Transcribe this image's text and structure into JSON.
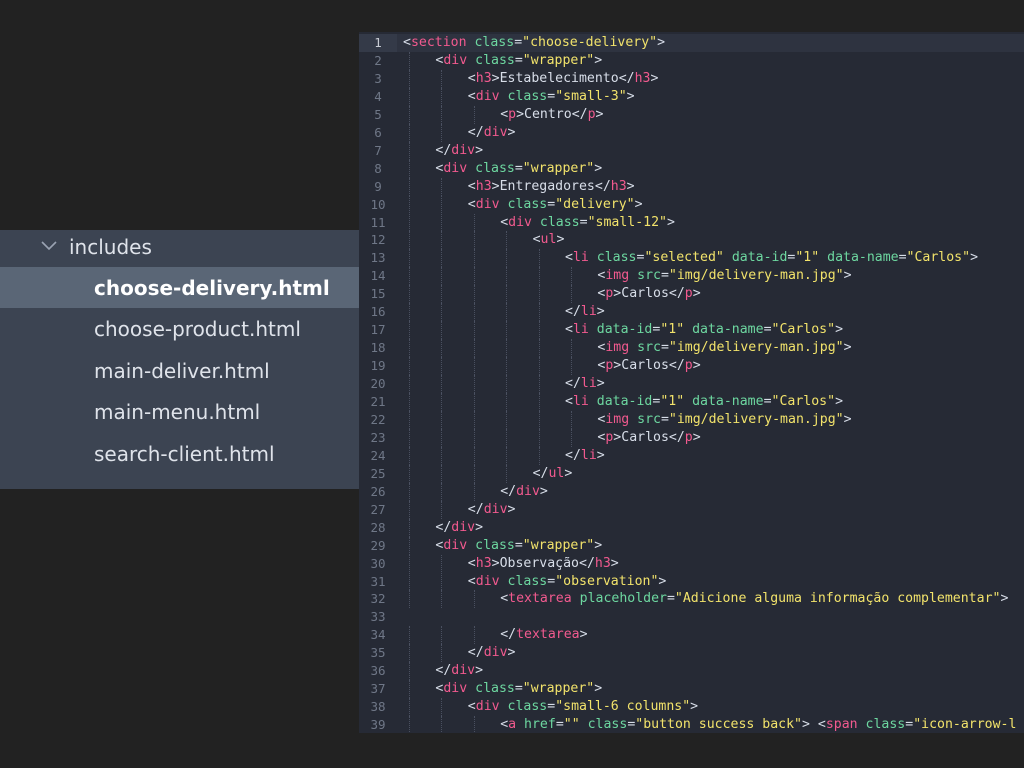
{
  "sidebar": {
    "folder": {
      "name": "includes",
      "icon": "chevron-down-icon"
    },
    "files": [
      {
        "name": "choose-delivery.html",
        "selected": true
      },
      {
        "name": "choose-product.html",
        "selected": false
      },
      {
        "name": "main-deliver.html",
        "selected": false
      },
      {
        "name": "main-menu.html",
        "selected": false
      },
      {
        "name": "search-client.html",
        "selected": false
      }
    ]
  },
  "editor": {
    "active_line": 1,
    "colors": {
      "tag": "#f25a8f",
      "attribute": "#6dd7a0",
      "string": "#f2e36b",
      "text": "#d8dee9"
    },
    "lines": [
      {
        "n": "1",
        "indent": 0,
        "tokens": [
          [
            "p",
            "<"
          ],
          [
            "tag",
            "section"
          ],
          [
            "p",
            " "
          ],
          [
            "attr",
            "class"
          ],
          [
            "p",
            "="
          ],
          [
            "str",
            "\"choose-delivery\""
          ],
          [
            "p",
            ">"
          ]
        ]
      },
      {
        "n": "2",
        "indent": 1,
        "tokens": [
          [
            "p",
            "<"
          ],
          [
            "tag",
            "div"
          ],
          [
            "p",
            " "
          ],
          [
            "attr",
            "class"
          ],
          [
            "p",
            "="
          ],
          [
            "str",
            "\"wrapper\""
          ],
          [
            "p",
            ">"
          ]
        ]
      },
      {
        "n": "3",
        "indent": 2,
        "tokens": [
          [
            "p",
            "<"
          ],
          [
            "tag",
            "h3"
          ],
          [
            "p",
            ">"
          ],
          [
            "t",
            "Estabelecimento"
          ],
          [
            "p",
            "</"
          ],
          [
            "tag",
            "h3"
          ],
          [
            "p",
            ">"
          ]
        ]
      },
      {
        "n": "4",
        "indent": 2,
        "tokens": [
          [
            "p",
            "<"
          ],
          [
            "tag",
            "div"
          ],
          [
            "p",
            " "
          ],
          [
            "attr",
            "class"
          ],
          [
            "p",
            "="
          ],
          [
            "str",
            "\"small-3\""
          ],
          [
            "p",
            ">"
          ]
        ]
      },
      {
        "n": "5",
        "indent": 3,
        "tokens": [
          [
            "p",
            "<"
          ],
          [
            "tag",
            "p"
          ],
          [
            "p",
            ">"
          ],
          [
            "t",
            "Centro"
          ],
          [
            "p",
            "</"
          ],
          [
            "tag",
            "p"
          ],
          [
            "p",
            ">"
          ]
        ]
      },
      {
        "n": "6",
        "indent": 2,
        "tokens": [
          [
            "p",
            "</"
          ],
          [
            "tag",
            "div"
          ],
          [
            "p",
            ">"
          ]
        ]
      },
      {
        "n": "7",
        "indent": 1,
        "tokens": [
          [
            "p",
            "</"
          ],
          [
            "tag",
            "div"
          ],
          [
            "p",
            ">"
          ]
        ]
      },
      {
        "n": "8",
        "indent": 1,
        "tokens": [
          [
            "p",
            "<"
          ],
          [
            "tag",
            "div"
          ],
          [
            "p",
            " "
          ],
          [
            "attr",
            "class"
          ],
          [
            "p",
            "="
          ],
          [
            "str",
            "\"wrapper\""
          ],
          [
            "p",
            ">"
          ]
        ]
      },
      {
        "n": "9",
        "indent": 2,
        "tokens": [
          [
            "p",
            "<"
          ],
          [
            "tag",
            "h3"
          ],
          [
            "p",
            ">"
          ],
          [
            "t",
            "Entregadores"
          ],
          [
            "p",
            "</"
          ],
          [
            "tag",
            "h3"
          ],
          [
            "p",
            ">"
          ]
        ]
      },
      {
        "n": "10",
        "indent": 2,
        "tokens": [
          [
            "p",
            "<"
          ],
          [
            "tag",
            "div"
          ],
          [
            "p",
            " "
          ],
          [
            "attr",
            "class"
          ],
          [
            "p",
            "="
          ],
          [
            "str",
            "\"delivery\""
          ],
          [
            "p",
            ">"
          ]
        ]
      },
      {
        "n": "11",
        "indent": 3,
        "tokens": [
          [
            "p",
            "<"
          ],
          [
            "tag",
            "div"
          ],
          [
            "p",
            " "
          ],
          [
            "attr",
            "class"
          ],
          [
            "p",
            "="
          ],
          [
            "str",
            "\"small-12\""
          ],
          [
            "p",
            ">"
          ]
        ]
      },
      {
        "n": "12",
        "indent": 4,
        "tokens": [
          [
            "p",
            "<"
          ],
          [
            "tag",
            "ul"
          ],
          [
            "p",
            ">"
          ]
        ]
      },
      {
        "n": "13",
        "indent": 5,
        "tokens": [
          [
            "p",
            "<"
          ],
          [
            "tag",
            "li"
          ],
          [
            "p",
            " "
          ],
          [
            "attr",
            "class"
          ],
          [
            "p",
            "="
          ],
          [
            "str",
            "\"selected\""
          ],
          [
            "p",
            " "
          ],
          [
            "attr",
            "data-id"
          ],
          [
            "p",
            "="
          ],
          [
            "str",
            "\"1\""
          ],
          [
            "p",
            " "
          ],
          [
            "attr",
            "data-name"
          ],
          [
            "p",
            "="
          ],
          [
            "str",
            "\"Carlos\""
          ],
          [
            "p",
            ">"
          ]
        ]
      },
      {
        "n": "14",
        "indent": 6,
        "tokens": [
          [
            "p",
            "<"
          ],
          [
            "tag",
            "img"
          ],
          [
            "p",
            " "
          ],
          [
            "attr",
            "src"
          ],
          [
            "p",
            "="
          ],
          [
            "str",
            "\"img/delivery-man.jpg\""
          ],
          [
            "p",
            ">"
          ]
        ]
      },
      {
        "n": "15",
        "indent": 6,
        "tokens": [
          [
            "p",
            "<"
          ],
          [
            "tag",
            "p"
          ],
          [
            "p",
            ">"
          ],
          [
            "t",
            "Carlos"
          ],
          [
            "p",
            "</"
          ],
          [
            "tag",
            "p"
          ],
          [
            "p",
            ">"
          ]
        ]
      },
      {
        "n": "16",
        "indent": 5,
        "tokens": [
          [
            "p",
            "</"
          ],
          [
            "tag",
            "li"
          ],
          [
            "p",
            ">"
          ]
        ]
      },
      {
        "n": "17",
        "indent": 5,
        "tokens": [
          [
            "p",
            "<"
          ],
          [
            "tag",
            "li"
          ],
          [
            "p",
            " "
          ],
          [
            "attr",
            "data-id"
          ],
          [
            "p",
            "="
          ],
          [
            "str",
            "\"1\""
          ],
          [
            "p",
            " "
          ],
          [
            "attr",
            "data-name"
          ],
          [
            "p",
            "="
          ],
          [
            "str",
            "\"Carlos\""
          ],
          [
            "p",
            ">"
          ]
        ]
      },
      {
        "n": "18",
        "indent": 6,
        "tokens": [
          [
            "p",
            "<"
          ],
          [
            "tag",
            "img"
          ],
          [
            "p",
            " "
          ],
          [
            "attr",
            "src"
          ],
          [
            "p",
            "="
          ],
          [
            "str",
            "\"img/delivery-man.jpg\""
          ],
          [
            "p",
            ">"
          ]
        ]
      },
      {
        "n": "19",
        "indent": 6,
        "tokens": [
          [
            "p",
            "<"
          ],
          [
            "tag",
            "p"
          ],
          [
            "p",
            ">"
          ],
          [
            "t",
            "Carlos"
          ],
          [
            "p",
            "</"
          ],
          [
            "tag",
            "p"
          ],
          [
            "p",
            ">"
          ]
        ]
      },
      {
        "n": "20",
        "indent": 5,
        "tokens": [
          [
            "p",
            "</"
          ],
          [
            "tag",
            "li"
          ],
          [
            "p",
            ">"
          ]
        ]
      },
      {
        "n": "21",
        "indent": 5,
        "tokens": [
          [
            "p",
            "<"
          ],
          [
            "tag",
            "li"
          ],
          [
            "p",
            " "
          ],
          [
            "attr",
            "data-id"
          ],
          [
            "p",
            "="
          ],
          [
            "str",
            "\"1\""
          ],
          [
            "p",
            " "
          ],
          [
            "attr",
            "data-name"
          ],
          [
            "p",
            "="
          ],
          [
            "str",
            "\"Carlos\""
          ],
          [
            "p",
            ">"
          ]
        ]
      },
      {
        "n": "22",
        "indent": 6,
        "tokens": [
          [
            "p",
            "<"
          ],
          [
            "tag",
            "img"
          ],
          [
            "p",
            " "
          ],
          [
            "attr",
            "src"
          ],
          [
            "p",
            "="
          ],
          [
            "str",
            "\"img/delivery-man.jpg\""
          ],
          [
            "p",
            ">"
          ]
        ]
      },
      {
        "n": "23",
        "indent": 6,
        "tokens": [
          [
            "p",
            "<"
          ],
          [
            "tag",
            "p"
          ],
          [
            "p",
            ">"
          ],
          [
            "t",
            "Carlos"
          ],
          [
            "p",
            "</"
          ],
          [
            "tag",
            "p"
          ],
          [
            "p",
            ">"
          ]
        ]
      },
      {
        "n": "24",
        "indent": 5,
        "tokens": [
          [
            "p",
            "</"
          ],
          [
            "tag",
            "li"
          ],
          [
            "p",
            ">"
          ]
        ]
      },
      {
        "n": "25",
        "indent": 4,
        "tokens": [
          [
            "p",
            "</"
          ],
          [
            "tag",
            "ul"
          ],
          [
            "p",
            ">"
          ]
        ]
      },
      {
        "n": "26",
        "indent": 3,
        "tokens": [
          [
            "p",
            "</"
          ],
          [
            "tag",
            "div"
          ],
          [
            "p",
            ">"
          ]
        ]
      },
      {
        "n": "27",
        "indent": 2,
        "tokens": [
          [
            "p",
            "</"
          ],
          [
            "tag",
            "div"
          ],
          [
            "p",
            ">"
          ]
        ]
      },
      {
        "n": "28",
        "indent": 1,
        "tokens": [
          [
            "p",
            "</"
          ],
          [
            "tag",
            "div"
          ],
          [
            "p",
            ">"
          ]
        ]
      },
      {
        "n": "29",
        "indent": 1,
        "tokens": [
          [
            "p",
            "<"
          ],
          [
            "tag",
            "div"
          ],
          [
            "p",
            " "
          ],
          [
            "attr",
            "class"
          ],
          [
            "p",
            "="
          ],
          [
            "str",
            "\"wrapper\""
          ],
          [
            "p",
            ">"
          ]
        ]
      },
      {
        "n": "30",
        "indent": 2,
        "tokens": [
          [
            "p",
            "<"
          ],
          [
            "tag",
            "h3"
          ],
          [
            "p",
            ">"
          ],
          [
            "t",
            "Observação"
          ],
          [
            "p",
            "</"
          ],
          [
            "tag",
            "h3"
          ],
          [
            "p",
            ">"
          ]
        ]
      },
      {
        "n": "31",
        "indent": 2,
        "tokens": [
          [
            "p",
            "<"
          ],
          [
            "tag",
            "div"
          ],
          [
            "p",
            " "
          ],
          [
            "attr",
            "class"
          ],
          [
            "p",
            "="
          ],
          [
            "str",
            "\"observation\""
          ],
          [
            "p",
            ">"
          ]
        ]
      },
      {
        "n": "32",
        "indent": 3,
        "tokens": [
          [
            "p",
            "<"
          ],
          [
            "tag",
            "textarea"
          ],
          [
            "p",
            " "
          ],
          [
            "attr",
            "placeholder"
          ],
          [
            "p",
            "="
          ],
          [
            "str",
            "\"Adicione alguma informação complementar\""
          ],
          [
            "p",
            ">"
          ]
        ]
      },
      {
        "n": "33",
        "indent": 0,
        "tokens": []
      },
      {
        "n": "34",
        "indent": 3,
        "tokens": [
          [
            "p",
            "</"
          ],
          [
            "tag",
            "textarea"
          ],
          [
            "p",
            ">"
          ]
        ]
      },
      {
        "n": "35",
        "indent": 2,
        "tokens": [
          [
            "p",
            "</"
          ],
          [
            "tag",
            "div"
          ],
          [
            "p",
            ">"
          ]
        ]
      },
      {
        "n": "36",
        "indent": 1,
        "tokens": [
          [
            "p",
            "</"
          ],
          [
            "tag",
            "div"
          ],
          [
            "p",
            ">"
          ]
        ]
      },
      {
        "n": "37",
        "indent": 1,
        "tokens": [
          [
            "p",
            "<"
          ],
          [
            "tag",
            "div"
          ],
          [
            "p",
            " "
          ],
          [
            "attr",
            "class"
          ],
          [
            "p",
            "="
          ],
          [
            "str",
            "\"wrapper\""
          ],
          [
            "p",
            ">"
          ]
        ]
      },
      {
        "n": "38",
        "indent": 2,
        "tokens": [
          [
            "p",
            "<"
          ],
          [
            "tag",
            "div"
          ],
          [
            "p",
            " "
          ],
          [
            "attr",
            "class"
          ],
          [
            "p",
            "="
          ],
          [
            "str",
            "\"small-6 columns\""
          ],
          [
            "p",
            ">"
          ]
        ]
      },
      {
        "n": "39",
        "indent": 3,
        "tokens": [
          [
            "p",
            "<"
          ],
          [
            "tag",
            "a"
          ],
          [
            "p",
            " "
          ],
          [
            "attr",
            "href"
          ],
          [
            "p",
            "="
          ],
          [
            "str",
            "\"\""
          ],
          [
            "p",
            " "
          ],
          [
            "attr",
            "class"
          ],
          [
            "p",
            "="
          ],
          [
            "str",
            "\"button success back\""
          ],
          [
            "p",
            "> <"
          ],
          [
            "tag",
            "span"
          ],
          [
            "p",
            " "
          ],
          [
            "attr",
            "class"
          ],
          [
            "p",
            "="
          ],
          [
            "str",
            "\"icon-arrow-l"
          ]
        ]
      }
    ]
  }
}
